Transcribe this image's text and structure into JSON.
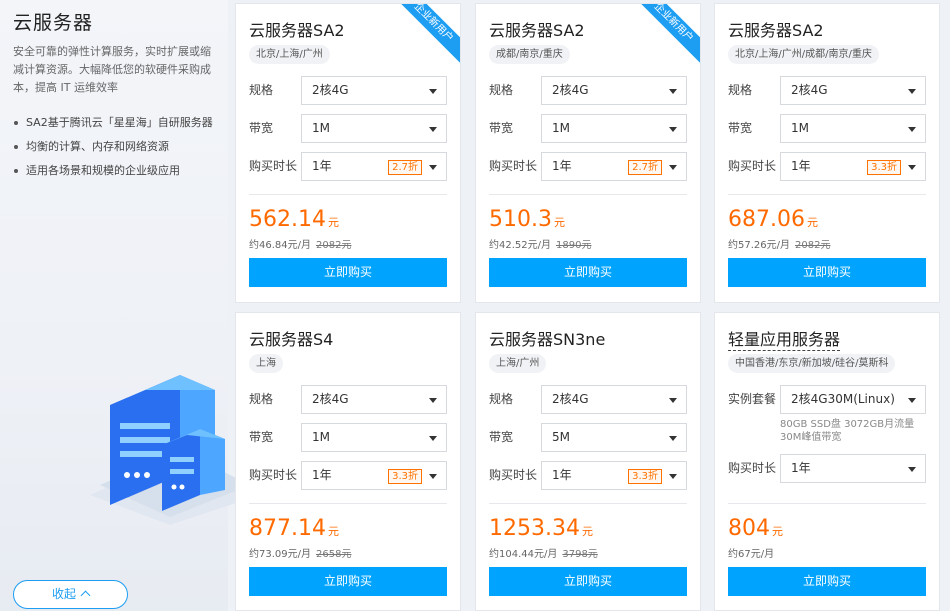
{
  "side": {
    "title": "云服务器",
    "description": "安全可靠的弹性计算服务，实时扩展或缩减计算资源。大幅降低您的软硬件采购成本，提高 IT 运维效率",
    "features": [
      "SA2基于腾讯云「星星海」自研服务器",
      "均衡的计算、内存和网络资源",
      "适用各场景和规模的企业级应用"
    ],
    "collapse_label": "收起"
  },
  "labels": {
    "spec": "规格",
    "bandwidth": "带宽",
    "duration": "购买时长",
    "instance_plan": "实例套餐",
    "buy": "立即购买"
  },
  "cards": [
    {
      "title": "云服务器SA2",
      "region": "北京/上海/广州",
      "ribbon": "企业新用户",
      "spec": "2核4G",
      "bandwidth": "1M",
      "duration": "1年",
      "discount": "2.7折",
      "price": "562.14",
      "unit": "元",
      "monthly": "约46.84元/月",
      "original": "2082元"
    },
    {
      "title": "云服务器SA2",
      "region": "成都/南京/重庆",
      "ribbon": "企业新用户",
      "spec": "2核4G",
      "bandwidth": "1M",
      "duration": "1年",
      "discount": "2.7折",
      "price": "510.3",
      "unit": "元",
      "monthly": "约42.52元/月",
      "original": "1890元"
    },
    {
      "title": "云服务器SA2",
      "region": "北京/上海/广州/成都/南京/重庆",
      "spec": "2核4G",
      "bandwidth": "1M",
      "duration": "1年",
      "discount": "3.3折",
      "price": "687.06",
      "unit": "元",
      "monthly": "约57.26元/月",
      "original": "2082元"
    },
    {
      "title": "云服务器S4",
      "region": "上海",
      "spec": "2核4G",
      "bandwidth": "1M",
      "duration": "1年",
      "discount": "3.3折",
      "price": "877.14",
      "unit": "元",
      "monthly": "约73.09元/月",
      "original": "2658元"
    },
    {
      "title": "云服务器SN3ne",
      "region": "上海/广州",
      "spec": "2核4G",
      "bandwidth": "5M",
      "duration": "1年",
      "discount": "3.3折",
      "price": "1253.34",
      "unit": "元",
      "monthly": "约104.44元/月",
      "original": "3798元"
    },
    {
      "title": "轻量应用服务器",
      "region": "中国香港/东京/新加坡/硅谷/莫斯科",
      "plan": "2核4G30M(Linux)",
      "plan_note": "80GB SSD盘 3072GB月流量 30M峰值带宽",
      "duration": "1年",
      "price": "804",
      "unit": "元",
      "monthly": "约67元/月"
    }
  ],
  "colors": {
    "accent": "#00a4ff",
    "price": "#ff6a00",
    "discount": "#ff7200"
  }
}
